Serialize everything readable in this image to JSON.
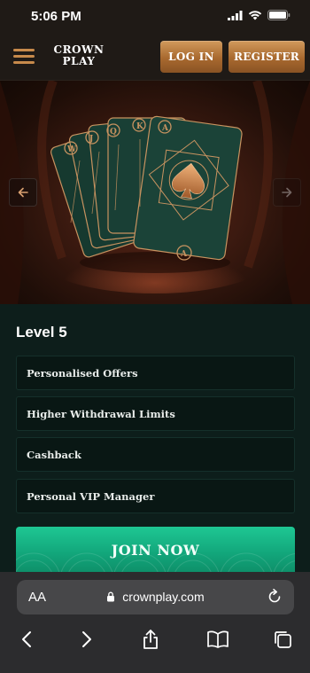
{
  "status_bar": {
    "time": "5:06 PM"
  },
  "header": {
    "logo_line1": "CROWN",
    "logo_line2": "PLAY",
    "login_label": "LOG IN",
    "register_label": "REGISTER"
  },
  "level": {
    "title": "Level 5",
    "perks": [
      {
        "label": "Personalised Offers"
      },
      {
        "label": "Higher Withdrawal Limits"
      },
      {
        "label": "Cashback"
      },
      {
        "label": "Personal VIP Manager"
      }
    ],
    "join_label": "JOIN NOW"
  },
  "browser": {
    "aa_label": "AA",
    "url": "crownplay.com"
  },
  "colors": {
    "accent_gold": "#c78a4b",
    "join_green": "#1ec793",
    "panel_bg": "#0d1e1b"
  }
}
